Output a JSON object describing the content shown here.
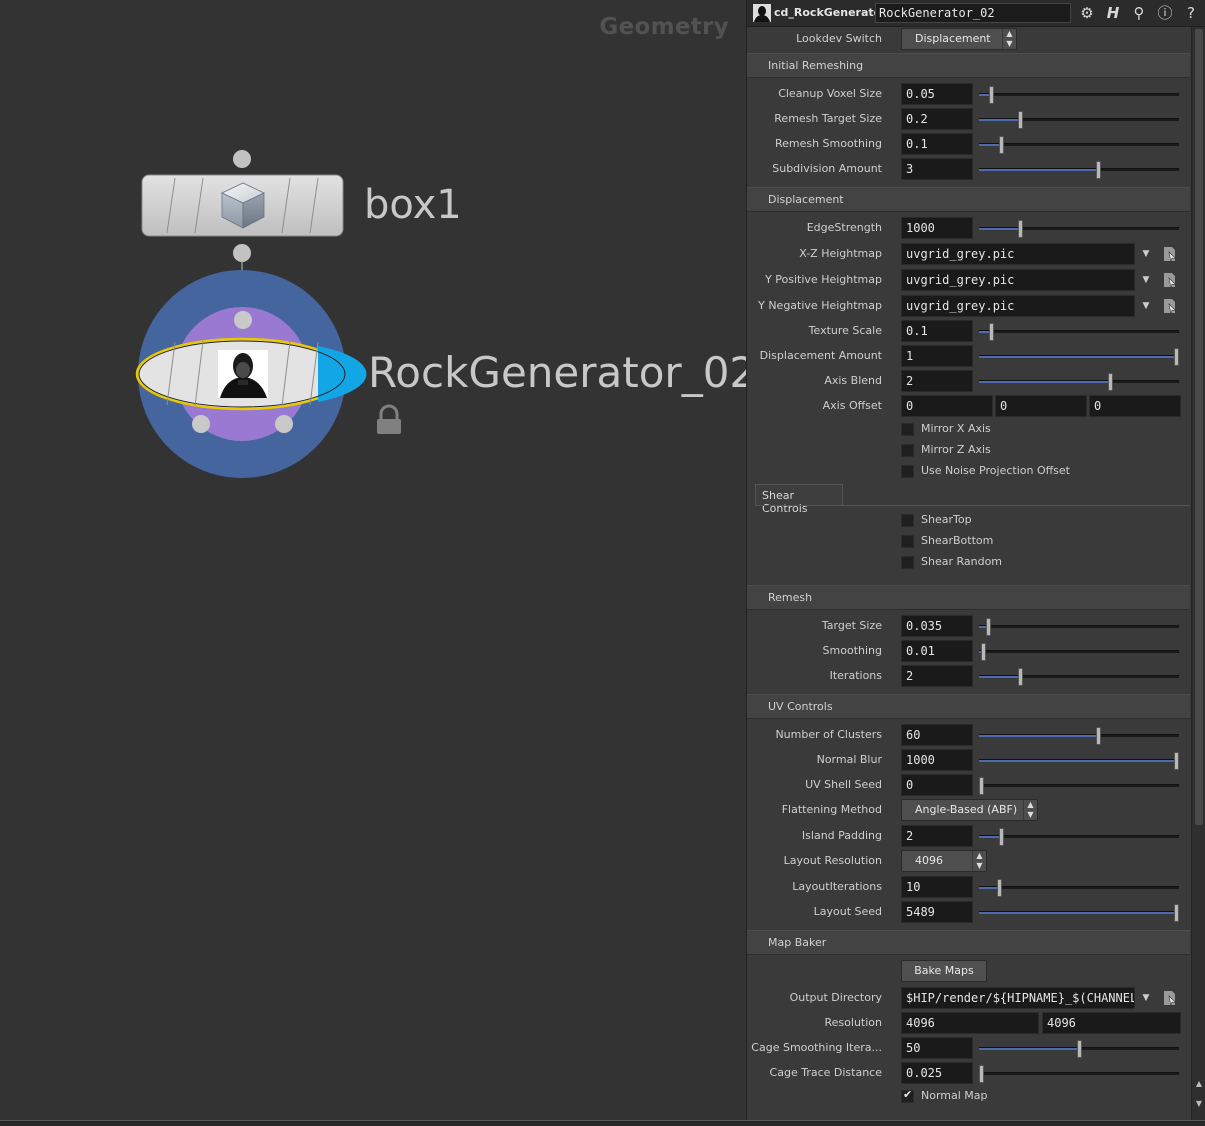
{
  "network": {
    "context_label": "Geometry",
    "nodes": {
      "box1": {
        "name": "box1"
      },
      "rock": {
        "name": "RockGenerator_02"
      }
    }
  },
  "header": {
    "node_type": "cd_RockGenerator",
    "node_name": "RockGenerator_02",
    "icons": [
      "gear-icon",
      "help-h-icon",
      "search-icon",
      "info-icon",
      "help-icon"
    ]
  },
  "params": {
    "lookdev_switch": {
      "label": "Lookdev Switch",
      "value": "Displacement"
    },
    "folders": {
      "initial_remeshing": "Initial Remeshing",
      "displacement": "Displacement",
      "remesh": "Remesh",
      "uv_controls": "UV Controls",
      "map_baker": "Map Baker"
    },
    "cleanup_voxel_size": {
      "label": "Cleanup Voxel Size",
      "value": "0.05",
      "level": 0.05
    },
    "remesh_target_size": {
      "label": "Remesh Target Size",
      "value": "0.2",
      "level": 0.2
    },
    "remesh_smoothing": {
      "label": "Remesh Smoothing",
      "value": "0.1",
      "level": 0.1
    },
    "subdivision_amount": {
      "label": "Subdivision Amount",
      "value": "3",
      "level": 0.6
    },
    "edge_strength": {
      "label": "EdgeStrength",
      "value": "1000",
      "level": 0.2
    },
    "xz_heightmap": {
      "label": "X-Z Heightmap",
      "value": "uvgrid_grey.pic"
    },
    "y_pos_heightmap": {
      "label": "Y Positive Heightmap",
      "value": "uvgrid_grey.pic"
    },
    "y_neg_heightmap": {
      "label": "Y Negative Heightmap",
      "value": "uvgrid_grey.pic"
    },
    "texture_scale": {
      "label": "Texture Scale",
      "value": "0.1",
      "level": 0.05
    },
    "displacement_amount": {
      "label": "Displacement Amount",
      "value": "1",
      "level": 1.0
    },
    "axis_blend": {
      "label": "Axis Blend",
      "value": "2",
      "level": 0.66
    },
    "axis_offset": {
      "label": "Axis Offset",
      "x": "0",
      "y": "0",
      "z": "0"
    },
    "mirror_x": {
      "label": "Mirror X Axis",
      "checked": false
    },
    "mirror_z": {
      "label": "Mirror Z Axis",
      "checked": false
    },
    "noise_proj": {
      "label": "Use Noise Projection Offset",
      "checked": false
    },
    "shear_tab": "Shear Controls",
    "shear_top": {
      "label": "ShearTop",
      "checked": false
    },
    "shear_bottom": {
      "label": "ShearBottom",
      "checked": false
    },
    "shear_random": {
      "label": "Shear Random",
      "checked": false
    },
    "target_size": {
      "label": "Target Size",
      "value": "0.035",
      "level": 0.035
    },
    "smoothing": {
      "label": "Smoothing",
      "value": "0.01",
      "level": 0.01
    },
    "iterations": {
      "label": "Iterations",
      "value": "2",
      "level": 0.2
    },
    "num_clusters": {
      "label": "Number of Clusters",
      "value": "60",
      "level": 0.6
    },
    "normal_blur": {
      "label": "Normal Blur",
      "value": "1000",
      "level": 1.0
    },
    "uv_shell_seed": {
      "label": "UV Shell Seed",
      "value": "0",
      "level": 0.0
    },
    "flattening_method": {
      "label": "Flattening Method",
      "value": "Angle-Based (ABF)"
    },
    "island_padding": {
      "label": "Island Padding",
      "value": "2",
      "level": 0.1
    },
    "layout_resolution": {
      "label": "Layout Resolution",
      "value": "4096"
    },
    "layout_iterations": {
      "label": "LayoutIterations",
      "value": "10",
      "level": 0.09
    },
    "layout_seed": {
      "label": "Layout Seed",
      "value": "5489",
      "level": 1.0
    },
    "bake_maps": "Bake Maps",
    "output_directory": {
      "label": "Output Directory",
      "value": "$HIP/render/${HIPNAME}_$(CHANNEL)"
    },
    "resolution": {
      "label": "Resolution",
      "x": "4096",
      "y": "4096"
    },
    "cage_smoothing": {
      "label": "Cage Smoothing Itera...",
      "value": "50",
      "level": 0.5
    },
    "cage_trace": {
      "label": "Cage Trace Distance",
      "value": "0.025",
      "level": 0.0
    },
    "normal_map": {
      "label": "Normal Map",
      "checked": true
    }
  },
  "colors": {
    "accent_blue": "#4f6bb0",
    "node_outer": "#44659e",
    "node_inner": "#9a79d2",
    "selection": "#e8c800",
    "flag_cyan": "#13a6e6"
  }
}
